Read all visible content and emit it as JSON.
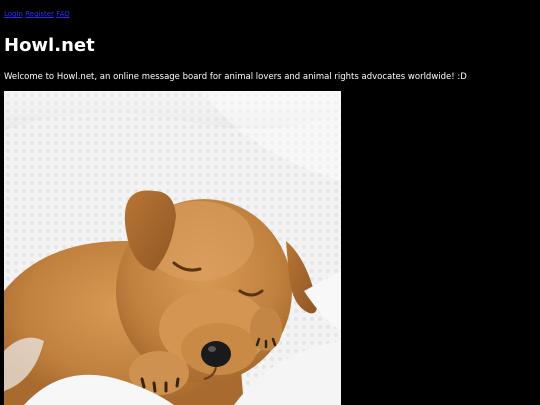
{
  "nav": {
    "login_label": "Login",
    "separator": " ",
    "register_label": "Register",
    "faq_label": "FAQ"
  },
  "header": {
    "title": "Howl.net"
  },
  "intro": {
    "welcome_text": "Welcome to Howl.net, an online message board for animal lovers and animal rights advocates worldwide! :D"
  },
  "image": {
    "subject": "sleeping-puppy-photo"
  },
  "colors": {
    "background": "#000000",
    "text": "#ffffff",
    "link": "#2a2aff",
    "puppy_fur": "#c98a45",
    "blanket": "#f3f3f3"
  }
}
